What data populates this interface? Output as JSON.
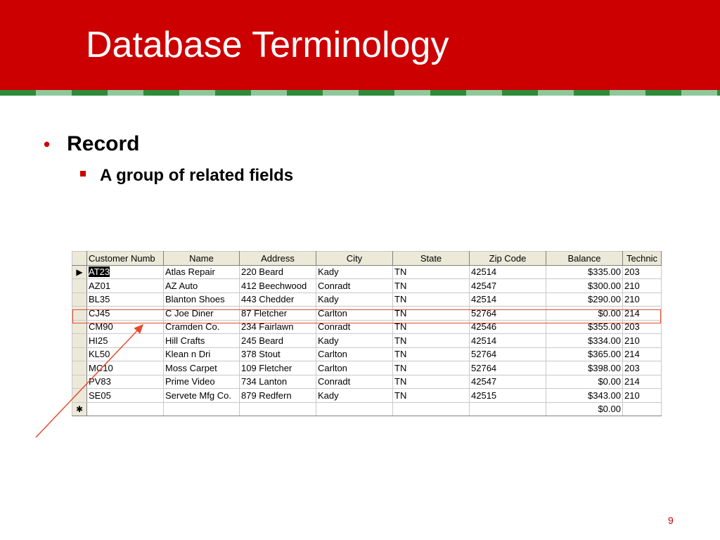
{
  "slide": {
    "title": "Database Terminology",
    "bullet_level1": "Record",
    "bullet_level2": "A group of related fields",
    "page_number": "9",
    "colors": {
      "header": "#cc0000",
      "stripe_dark": "#2e8b3a",
      "stripe_light": "#8fc89a",
      "highlight": "#e64a2e"
    }
  },
  "datasheet": {
    "columns": [
      "Customer Numb",
      "Name",
      "Address",
      "City",
      "State",
      "Zip Code",
      "Balance",
      "Technic"
    ],
    "rows": [
      [
        "AT23",
        "Atlas Repair",
        "220 Beard",
        "Kady",
        "TN",
        "42514",
        "$335.00",
        "203"
      ],
      [
        "AZ01",
        "AZ Auto",
        "412 Beechwood",
        "Conradt",
        "TN",
        "42547",
        "$300.00",
        "210"
      ],
      [
        "BL35",
        "Blanton Shoes",
        "443 Chedder",
        "Kady",
        "TN",
        "42514",
        "$290.00",
        "210"
      ],
      [
        "CJ45",
        "C Joe Diner",
        "87 Fletcher",
        "Carlton",
        "TN",
        "52764",
        "$0.00",
        "214"
      ],
      [
        "CM90",
        "Cramden Co.",
        "234 Fairlawn",
        "Conradt",
        "TN",
        "42546",
        "$355.00",
        "203"
      ],
      [
        "HI25",
        "Hill Crafts",
        "245 Beard",
        "Kady",
        "TN",
        "42514",
        "$334.00",
        "210"
      ],
      [
        "KL50",
        "Klean n Dri",
        "378 Stout",
        "Carlton",
        "TN",
        "52764",
        "$365.00",
        "214"
      ],
      [
        "MC10",
        "Moss Carpet",
        "109 Fletcher",
        "Carlton",
        "TN",
        "52764",
        "$398.00",
        "203"
      ],
      [
        "PV83",
        "Prime Video",
        "734 Lanton",
        "Conradt",
        "TN",
        "42547",
        "$0.00",
        "214"
      ],
      [
        "SE05",
        "Servete Mfg Co.",
        "879 Redfern",
        "Kady",
        "TN",
        "42515",
        "$343.00",
        "210"
      ]
    ],
    "new_row_balance": "$0.00",
    "current_row_indicator": "▶",
    "new_row_indicator": "✱",
    "highlighted_row_index": 3,
    "selected_cell": "AT23"
  }
}
